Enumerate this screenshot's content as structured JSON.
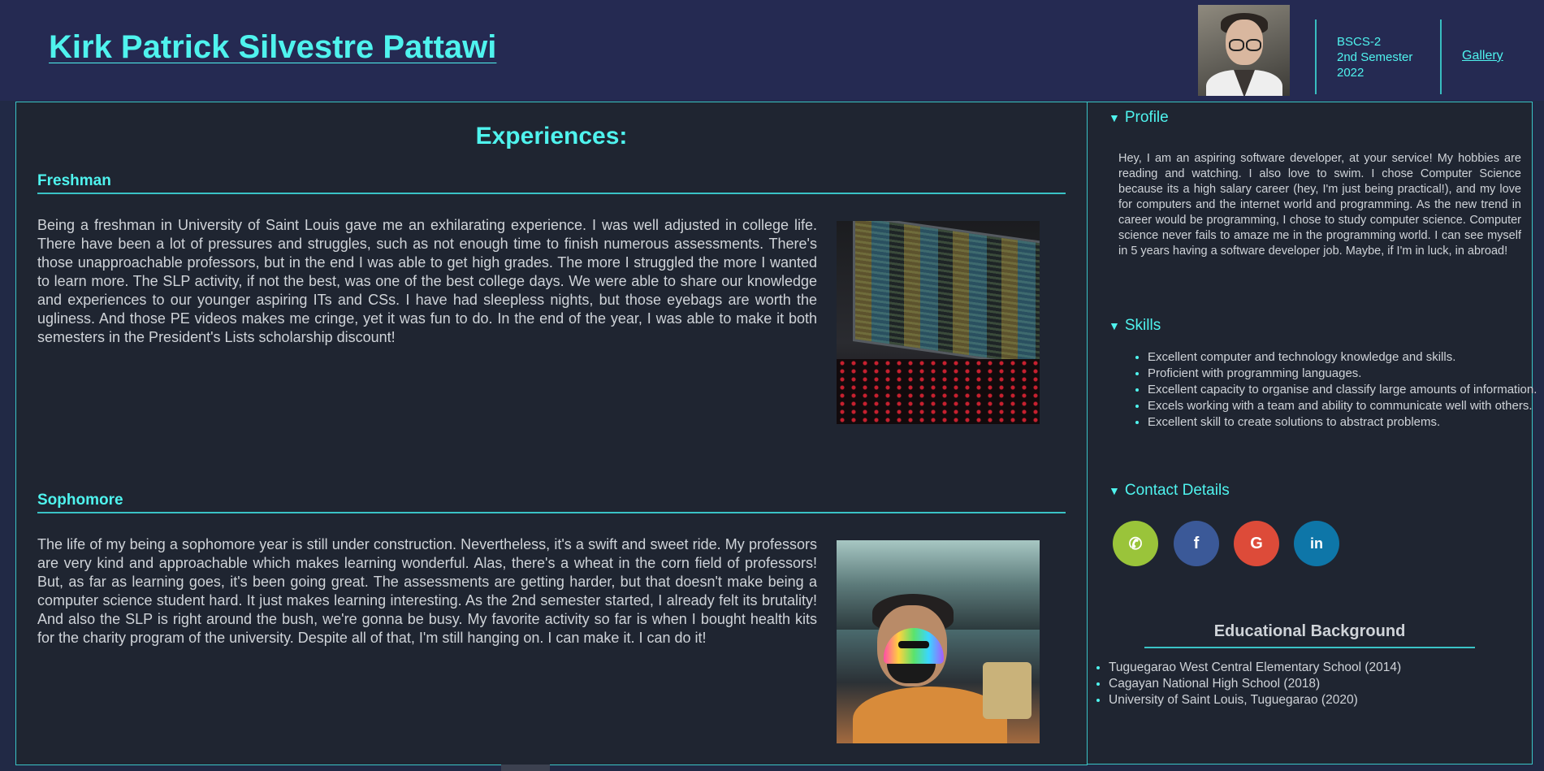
{
  "header": {
    "name": "Kirk Patrick Silvestre Pattawi",
    "meta_lines": [
      "BSCS-2",
      "2nd Semester",
      "2022"
    ],
    "gallery_link": "Gallery"
  },
  "experiences": {
    "title": "Experiences:",
    "sections": [
      {
        "heading": "Freshman",
        "text": "Being a freshman in University of Saint Louis gave me an exhilarating experience. I was well adjusted in college life. There have been a lot of pressures and struggles, such as not enough time to finish numerous assessments. There's those unapproachable professors, but in the end I was able to get high grades. The more I struggled the more I wanted to learn more. The SLP activity, if not the best, was one of the best college days. We were able to share our knowledge and experiences to our younger aspiring ITs and CSs. I have had sleepless nights, but those eyebags are worth the ugliness. And those PE videos makes me cringe, yet it was fun to do. In the end of the year, I was able to make it both semesters in the President's Lists scholarship discount!"
      },
      {
        "heading": "Sophomore",
        "text": "The life of my being a sophomore year is still under construction. Nevertheless, it's a swift and sweet ride. My professors are very kind and approachable which makes learning wonderful. Alas, there's a wheat in the corn field of professors! But, as far as learning goes, it's been going great. The assessments are getting harder, but that doesn't make being a computer science student hard. It just makes learning interesting. As the 2nd semester started, I already felt its brutality! And also the SLP is right around the bush, we're gonna be busy. My favorite activity so far is when I bought health kits for the charity program of the university. Despite all of that, I'm still hanging on. I can make it. I can do it!"
      }
    ]
  },
  "sidebar": {
    "profile": {
      "label": "Profile",
      "text": "Hey, I am an aspiring software developer, at your service! My hobbies are reading and watching. I also love to swim. I chose Computer Science because its a high salary career (hey, I'm just being practical!), and my love for computers and the internet world and programming. As the new trend in career would be programming, I chose to study computer science. Computer science never fails to amaze me in the programming world. I can see myself in 5 years having a software developer job. Maybe, if I'm in luck, in abroad!"
    },
    "skills": {
      "label": "Skills",
      "items": [
        "Excellent computer and technology knowledge and skills.",
        "Proficient with programming languages.",
        "Excellent capacity to organise and classify large amounts of information.",
        "Excels working with a team and ability to communicate well with others.",
        "Excellent skill to create solutions to abstract problems."
      ]
    },
    "contact": {
      "label": "Contact Details",
      "icons": [
        {
          "name": "phone-icon",
          "glyph": "✆",
          "color": "#9ac43a"
        },
        {
          "name": "facebook-icon",
          "glyph": "f",
          "color": "#3b5998"
        },
        {
          "name": "google-icon",
          "glyph": "G",
          "color": "#dd4b39"
        },
        {
          "name": "linkedin-icon",
          "glyph": "in",
          "color": "#0e76a8"
        }
      ]
    },
    "education": {
      "title": "Educational Background",
      "items": [
        "Tuguegarao West Central Elementary School (2014)",
        "Cagayan National High School (2018)",
        "University of Saint Louis, Tuguegarao (2020)"
      ]
    }
  },
  "colors": {
    "accent": "#4ff3ee",
    "border": "#3ac3c6",
    "header_bg": "#252a52",
    "panel_bg": "#1f2531"
  }
}
